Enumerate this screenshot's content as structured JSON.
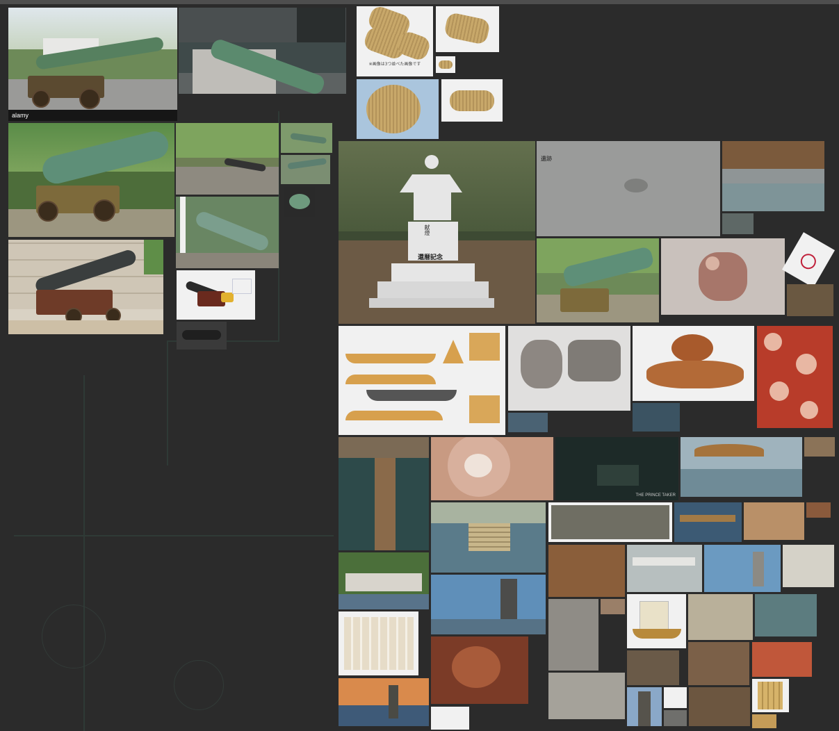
{
  "board": {
    "background": "#2b2b2b",
    "topbar_color": "#4e4e4e"
  },
  "images": {
    "cannon_park_alamy": {
      "watermark": "alamy",
      "alt": "bronze cannon on wooden carriage in park",
      "icon": "image-icon"
    },
    "cannon_stone_mount": {
      "alt": "green bronze cannon on granite mount"
    },
    "rice_bales_three": {
      "alt": "three straw rice bales",
      "caption": "※画像は3つ並べた画像です"
    },
    "rice_bale_single": {
      "alt": "single straw rice bale"
    },
    "rice_bale_small": {
      "alt": "small rice bale thumbnail"
    },
    "rice_bale_round": {
      "alt": "round straw bale on blue"
    },
    "rice_bale_white": {
      "alt": "straw bale on white"
    },
    "cannon_large_green": {
      "alt": "large green cannon with cafe tables"
    },
    "cannon_wall_small": {
      "alt": "cannon by stone wall"
    },
    "cannon_tiny_1": {
      "alt": "cannon thumbnail"
    },
    "cannon_tiny_2": {
      "alt": "cannon thumbnail"
    },
    "cannon_muzzle": {
      "alt": "cannon muzzle close-up"
    },
    "cannon_pillar": {
      "alt": "cannon near white pillar"
    },
    "cannon_red_carriage": {
      "alt": "iron cannon on red wooden carriage by stone wall"
    },
    "cannon_model": {
      "alt": "black cannon 3D model with blueprint"
    },
    "cannon_model_small": {
      "alt": "cannon model thumbnail"
    },
    "stone_lantern_monument": {
      "alt": "stone lantern monument in forest",
      "inscription_top": "献燈",
      "inscription_main": "還暦記念"
    },
    "sand_footprint": {
      "alt": "sand surface texture",
      "label": "遺跡"
    },
    "harbor_model": {
      "alt": "Edo harbor diorama"
    },
    "harbor_model_small": {
      "alt": "diorama thumbnail"
    },
    "cannon_green_2": {
      "alt": "green cannon with cafe"
    },
    "octopus_sucker": {
      "alt": "octopus sucker close-up"
    },
    "stamp_seal": {
      "alt": "red stamp seal"
    },
    "wood_dock": {
      "alt": "wooden dock"
    },
    "boat_papercraft": {
      "alt": "wooden boat papercraft template"
    },
    "stone_rocks": {
      "alt": "stone fragments in hand"
    },
    "octopus_whole": {
      "alt": "octopus on white"
    },
    "octopus_tentacle": {
      "alt": "red octopus tentacle"
    },
    "sea_thumb": {
      "alt": "sea thumbnail"
    },
    "sea_thumb2": {
      "alt": "sea thumbnail"
    },
    "pier_night": {
      "alt": "Edo pier diorama aerial"
    },
    "sucker_macro": {
      "alt": "octopus sucker macro"
    },
    "dark_alley": {
      "alt": "dark game scene",
      "caption": "THE PRINCE TAKER"
    },
    "bridge_diorama": {
      "alt": "bridge diorama"
    },
    "bridge_thumb": {
      "alt": "thumbnail"
    },
    "stone_steps_water": {
      "alt": "stone steps by water"
    },
    "old_print": {
      "alt": "old woodblock print panorama"
    },
    "ukiyoe_bridge": {
      "alt": "ukiyo-e bridge print"
    },
    "market_diorama": {
      "alt": "market diorama"
    },
    "tiny_thumb": {
      "alt": "thumbnail"
    },
    "coastal_town": {
      "alt": "coastal town buildings"
    },
    "ship_wreck_model": {
      "alt": "ship wreck model"
    },
    "stone_bridge": {
      "alt": "stone bridge"
    },
    "lighthouse_lantern": {
      "alt": "stone lighthouse lantern"
    },
    "shop_street": {
      "alt": "old shop street"
    },
    "paper_charms": {
      "alt": "paper talismans collection"
    },
    "lantern_sky": {
      "alt": "stone lantern against blue sky"
    },
    "street_steps": {
      "alt": "street with steps"
    },
    "ship_model": {
      "alt": "Japanese sailing ship model"
    },
    "harbor_ships": {
      "alt": "harbor with ships"
    },
    "canal_diorama": {
      "alt": "canal diorama"
    },
    "octopus_red": {
      "alt": "red octopus underwater"
    },
    "wooden_house": {
      "alt": "wooden house"
    },
    "pier_model": {
      "alt": "pier model"
    },
    "tentacle_curl": {
      "alt": "octopus tentacle"
    },
    "sunset_lantern": {
      "alt": "sunset with stone lantern"
    },
    "ship_sketch": {
      "alt": "ship sketch"
    },
    "harbor_ground": {
      "alt": "harbor ground"
    },
    "lantern_tower": {
      "alt": "stone lantern tower"
    },
    "small_charm": {
      "alt": "small charm"
    },
    "small_stone": {
      "alt": "small stone"
    },
    "bridge_model": {
      "alt": "bridge model"
    },
    "bamboo": {
      "alt": "bamboo poles"
    },
    "bamboo_small": {
      "alt": "bamboo thumbnail"
    }
  }
}
